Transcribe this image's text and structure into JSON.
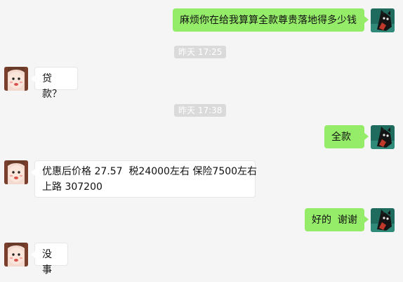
{
  "messages": [
    {
      "text": "麻烦你在给我算算全款尊贵落地得多少钱"
    },
    {
      "text": "贷款？"
    },
    {
      "text": "全款"
    },
    {
      "text": "优惠后价格 27.57  税24000左右 保险7500左右"
    },
    {
      "text": "上路 307200"
    },
    {
      "text": "好的  谢谢"
    },
    {
      "text": "没事"
    }
  ],
  "timestamps": [
    "昨天 17:25",
    "昨天 17:38"
  ],
  "avatars": {
    "me": "cat-avatar-icon",
    "other": "girl-avatar-icon"
  }
}
